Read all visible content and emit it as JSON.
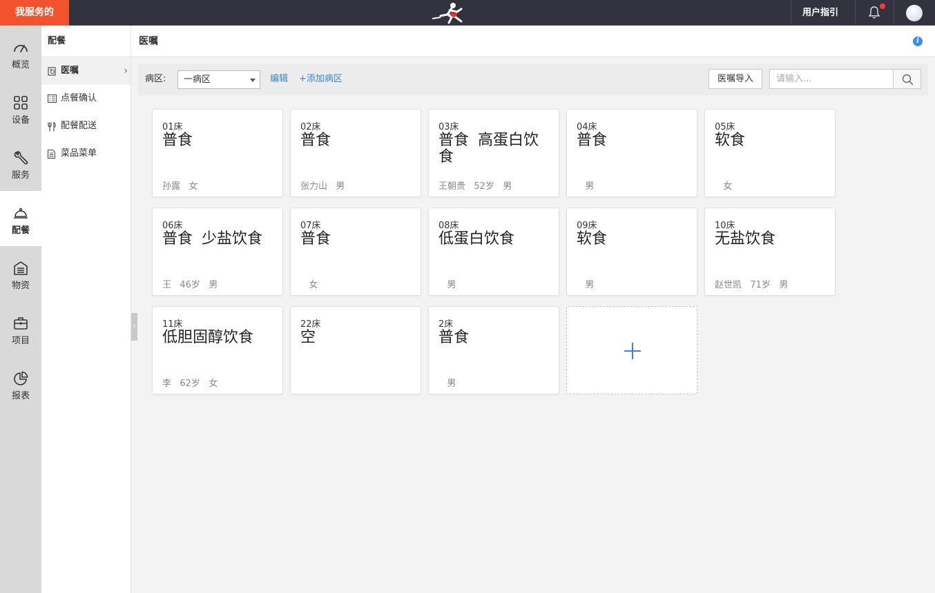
{
  "topbar": {
    "brand": "我服务的",
    "guide": "用户指引"
  },
  "nav": [
    {
      "label": "概览",
      "icon": "gauge-icon"
    },
    {
      "label": "设备",
      "icon": "grid-icon"
    },
    {
      "label": "服务",
      "icon": "wrench-icon"
    },
    {
      "label": "配餐",
      "icon": "cloche-icon",
      "active": true
    },
    {
      "label": "物资",
      "icon": "warehouse-icon"
    },
    {
      "label": "项目",
      "icon": "briefcase-icon"
    },
    {
      "label": "报表",
      "icon": "pie-chart-icon"
    }
  ],
  "submenu": {
    "title": "配餐",
    "items": [
      {
        "label": "医嘱",
        "icon": "order-icon",
        "active": true
      },
      {
        "label": "点餐确认",
        "icon": "checklist-icon"
      },
      {
        "label": "配餐配送",
        "icon": "fork-knife-icon"
      },
      {
        "label": "菜品菜单",
        "icon": "document-icon"
      }
    ]
  },
  "header": {
    "title": "医嘱"
  },
  "toolbar": {
    "ward_label": "病区:",
    "ward_value": "一病区",
    "edit": "编辑",
    "add_ward": "+添加病区",
    "import": "医嘱导入",
    "search_placeholder": "请输入..."
  },
  "cards": [
    {
      "bed": "01床",
      "diet": "普食",
      "info": "孙露   女"
    },
    {
      "bed": "02床",
      "diet": "普食",
      "info": "张力山   男"
    },
    {
      "bed": "03床",
      "diet": "普食 高蛋白饮食",
      "info": "王朝贵   52岁   男"
    },
    {
      "bed": "04床",
      "diet": "普食",
      "info": "   男"
    },
    {
      "bed": "05床",
      "diet": "软食",
      "info": "   女"
    },
    {
      "bed": "06床",
      "diet": "普食 少盐饮食",
      "info": "王   46岁   男"
    },
    {
      "bed": "07床",
      "diet": "普食",
      "info": "   女"
    },
    {
      "bed": "08床",
      "diet": "低蛋白饮食",
      "info": "   男"
    },
    {
      "bed": "09床",
      "diet": "软食",
      "info": "   男"
    },
    {
      "bed": "10床",
      "diet": "无盐饮食",
      "info": "赵世凯   71岁   男"
    },
    {
      "bed": "11床",
      "diet": "低胆固醇饮食",
      "info": "李   62岁   女"
    },
    {
      "bed": "22床",
      "diet": "空",
      "info": ""
    },
    {
      "bed": "2床",
      "diet": "普食",
      "info": "   男"
    }
  ],
  "colors": {
    "brand": "#f0532d",
    "topbar": "#33333f",
    "accent": "#3d82d8",
    "notification": "#ff3b30"
  }
}
